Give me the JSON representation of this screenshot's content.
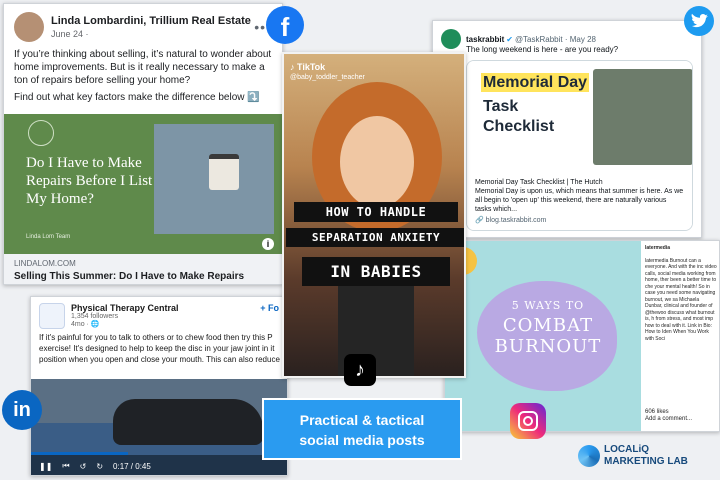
{
  "facebook": {
    "author": "Linda Lombardini, Trillium Real Estate",
    "date": "June 24 · ",
    "body_1": "If you’re thinking about selling, it’s natural to wonder about home improvements. But is it really necessary to make a ton of repairs before selling your home?",
    "body_2": "Find out what key factors make the difference below ⤵️",
    "image_title": "Do I Have to Make Repairs Before I List My Home?",
    "image_brand": "Linda Lom Team",
    "link_domain": "LINDALOM.COM",
    "link_title": "Selling This Summer: Do I Have to Make Repairs Before I List My Home?"
  },
  "twitter": {
    "name": "taskrabbit",
    "handle_date": "@TaskRabbit · May 28",
    "text": "The long weekend is here - are you ready?",
    "image_line_1": "Memorial Day",
    "image_line_2": "Task Checklist",
    "link_title": "Memorial Day Task Checklist | The Hutch",
    "link_desc": "Memorial Day is upon us, which means that summer is here. As we all begin to 'open up' this weekend, there are naturally various tasks which...",
    "link_domain": "🔗 blog.taskrabbit.com"
  },
  "tiktok": {
    "brand": "♪ TikTok",
    "handle": "@baby_toddler_teacher",
    "caption_1": "HOW TO HANDLE",
    "caption_2": "SEPARATION ANXIETY",
    "caption_3": "IN BABIES",
    "logo_glyph": "♪"
  },
  "instagram": {
    "line_1": "5 WAYS TO",
    "line_2": "COMBAT",
    "line_3": "BURNOUT",
    "account": "latermedia",
    "caption": "latermedia Burnout can a everyone. And with the inc video calls, social media working from home, ther been a better time to che your mental health! So in case you need some navigating burnout, we sa Michaela Dunbar, clinical and founder of @thewoo discuss what burnout is, h from stress, and most imp how to deal with it. Link in Bio: How to Iden When You Work with Soci",
    "likes": "606 likes",
    "comment_prompt": "Add a comment..."
  },
  "linkedin": {
    "name": "Physical Therapy Central",
    "followers": "1,354 followers",
    "age": "4mo · 🌐",
    "follow": "+ Fo",
    "text_1": "If it's painful for you to talk to others or to chew food then try this P",
    "text_2": "exercise! It's designed to help to keep the disc in your jaw joint in it",
    "text_3": "position when you open and close your mouth. This can also reduce",
    "time": "0:17 / 0:45",
    "progress": 0.38,
    "logo_text": "in"
  },
  "banner": {
    "line_1": "Practical & tactical",
    "line_2": "social media posts"
  },
  "brand": {
    "line_1": "LOCALiQ",
    "line_2": "MARKETING LAB"
  },
  "logos": {
    "facebook": "f"
  },
  "colors": {
    "facebook": "#1877f2",
    "twitter": "#1d9bf0",
    "linkedin": "#0a66c2",
    "banner": "#2a9bf0"
  }
}
